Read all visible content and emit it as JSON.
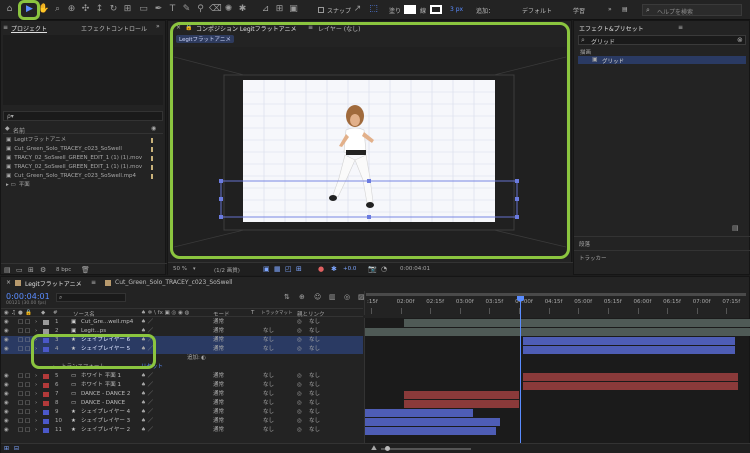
{
  "toolbar": {
    "snap_label": "スナップ",
    "fill_label": "塗り",
    "stroke_width": "3 px",
    "add_label": "追加：",
    "workspace_default": "デフォルト",
    "workspace_learn": "学習",
    "search_help_placeholder": "ヘルプを検索"
  },
  "project_panel": {
    "tab_project": "プロジェクト",
    "tab_effect_controls": "エフェクトコントロール",
    "search_placeholder": "ρ▾",
    "column_name": "名前",
    "items": [
      {
        "name": "Legitフラットアニメ",
        "type": "comp"
      },
      {
        "name": "Cut_Green_Solo_TRACEY_c023_SoSwell",
        "type": "comp"
      },
      {
        "name": "TRACY_02_SoSwell_GREEN_EDIT_1 (1) (1).mov",
        "type": "footage"
      },
      {
        "name": "TRACY_02_SoSwell_GREEN_EDIT_1 (1) (1).mov",
        "type": "footage"
      },
      {
        "name": "Cut_Green_Solo_TRACEY_c023_SoSwell.mp4",
        "type": "footage"
      },
      {
        "name": "平面",
        "type": "folder"
      }
    ],
    "bpc_label": "8 bpc"
  },
  "composition_panel": {
    "tab_label": "コンポジション Legitフラットアニメ",
    "layer_tab": "レイヤー (なし)",
    "breadcrumb": "Legitフラットアニメ",
    "zoom": "50 %",
    "resolution": "(1/2 画質)",
    "timecode": "0:00:04:01"
  },
  "effects_panel": {
    "title": "エフェクト&プリセット",
    "search_value": "グリッド",
    "category": "描画",
    "result": "グリッド",
    "bottom_items": [
      "段落",
      "トラッカー"
    ]
  },
  "timeline": {
    "tab_active": "Legitフラットアニメ",
    "tab_other": "Cut_Green_Solo_TRACEY_c023_SoSwell",
    "current_time": "0:00:04:01",
    "frame_info": "00121 (30.00 fps)",
    "col_source": "ソース名",
    "col_mode": "モード",
    "col_t": "T",
    "col_trkmat": "トラックマット",
    "col_parent": "親とリンク",
    "ruler": [
      ":15f",
      "02:00f",
      "02:15f",
      "03:00f",
      "03:15f",
      "04:00f",
      "04:15f",
      "05:00f",
      "05:15f",
      "06:00f",
      "06:15f",
      "07:00f",
      "07:15f"
    ],
    "layers": [
      {
        "num": "1",
        "name": "Cut_Gre...well.mp4",
        "mode": "通常",
        "trk": "",
        "parent": "なし",
        "color": "#9a9a9a"
      },
      {
        "num": "2",
        "name": "Legit...ps",
        "mode": "通常",
        "trk": "なし",
        "parent": "なし",
        "color": "#9a9a9a"
      },
      {
        "num": "3",
        "name": "シェイプレイヤー 6",
        "mode": "通常",
        "trk": "なし",
        "parent": "なし",
        "color": "#4b58c9"
      },
      {
        "num": "4",
        "name": "シェイプレイヤー 5",
        "mode": "通常",
        "trk": "なし",
        "parent": "なし",
        "color": "#4b58c9"
      },
      {
        "num": "5",
        "name": "ホワイト 平面 1",
        "mode": "通常",
        "trk": "なし",
        "parent": "なし",
        "color": "#b33a3a"
      },
      {
        "num": "6",
        "name": "ホワイト 平面 1",
        "mode": "通常",
        "trk": "なし",
        "parent": "なし",
        "color": "#b33a3a"
      },
      {
        "num": "7",
        "name": "DANCE - DANCE 2",
        "mode": "通常",
        "trk": "なし",
        "parent": "なし",
        "color": "#b33a3a"
      },
      {
        "num": "8",
        "name": "DANCE - DANCE",
        "mode": "通常",
        "trk": "なし",
        "parent": "なし",
        "color": "#b33a3a"
      },
      {
        "num": "9",
        "name": "シェイプレイヤー 4",
        "mode": "通常",
        "trk": "なし",
        "parent": "なし",
        "color": "#4b58c9"
      },
      {
        "num": "10",
        "name": "シェイプレイヤー 3",
        "mode": "通常",
        "trk": "なし",
        "parent": "なし",
        "color": "#4b58c9"
      },
      {
        "num": "11",
        "name": "シェイプレイヤー 2",
        "mode": "通常",
        "trk": "なし",
        "parent": "なし",
        "color": "#4b58c9"
      }
    ],
    "add_label": "追加:",
    "transform_label": "トランスフォーム",
    "reset_label": "リセット"
  },
  "colors": {
    "highlight_green": "#8bc53f",
    "playhead_blue": "#5a8cff",
    "selected_layer": "#2a3a63"
  }
}
